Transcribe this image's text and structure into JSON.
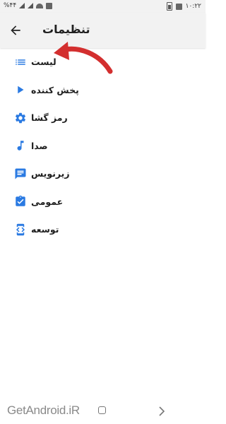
{
  "status_bar": {
    "time": "۱۰:۲۲",
    "left_text": "%۴۴"
  },
  "header": {
    "title": "تنظیمات",
    "back_icon": "arrow-back-icon"
  },
  "menu": {
    "items": [
      {
        "label": "لیست",
        "icon": "list-icon"
      },
      {
        "label": "پخش کننده",
        "icon": "play-icon"
      },
      {
        "label": "رمز گشا",
        "icon": "gear-icon"
      },
      {
        "label": "صدا",
        "icon": "music-note-icon"
      },
      {
        "label": "زیرنویس",
        "icon": "subtitles-icon"
      },
      {
        "label": "عمومی",
        "icon": "clipboard-check-icon"
      },
      {
        "label": "توسعه",
        "icon": "developer-mode-icon"
      }
    ]
  },
  "watermark": "GetAndroid.iR",
  "colors": {
    "accent": "#2a7ae2",
    "annotation": "#d32f2f",
    "bars": "#f2f2f2"
  }
}
